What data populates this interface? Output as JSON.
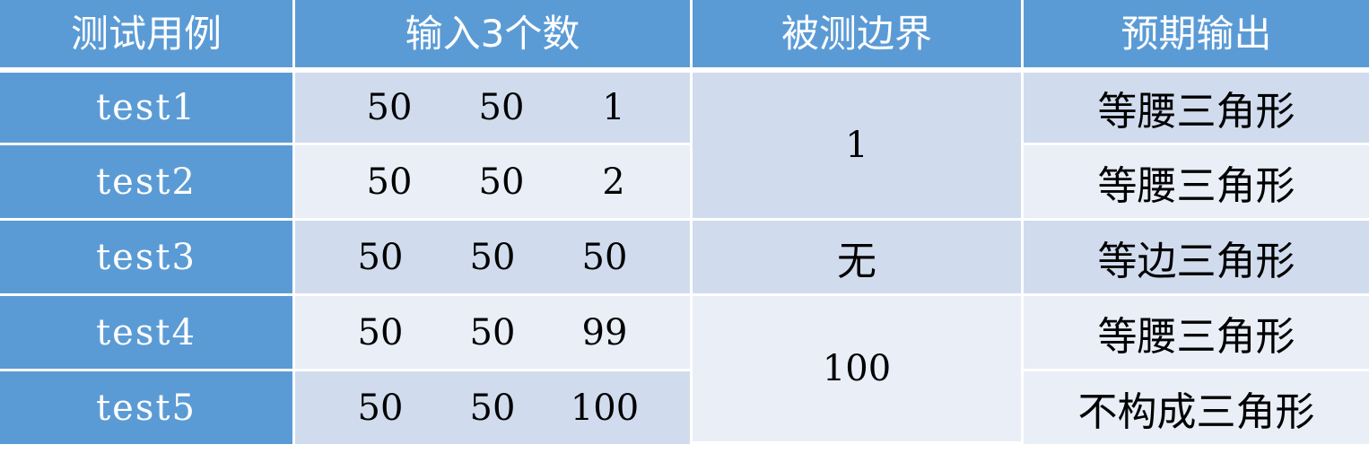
{
  "headers": [
    "测试用例",
    "输入3个数",
    "被测边界",
    "预期输出"
  ],
  "rows": [
    {
      "label": "test1",
      "inputs": [
        "50",
        "50",
        "1"
      ],
      "output": "等腰三角形"
    },
    {
      "label": "test2",
      "inputs": [
        "50",
        "50",
        "2"
      ],
      "output": "等腰三角形"
    },
    {
      "label": "test3",
      "inputs": [
        "50",
        "50",
        "50"
      ],
      "output": "等边三角形"
    },
    {
      "label": "test4",
      "inputs": [
        "50",
        "50",
        "99"
      ],
      "output": "等腰三角形"
    },
    {
      "label": "test5",
      "inputs": [
        "50",
        "50",
        "100"
      ],
      "output": "不构成三角形"
    }
  ],
  "boundaries": [
    "1",
    "无",
    "100"
  ],
  "colors": {
    "header": "#5b9bd5",
    "row_dark": "#d0dcee",
    "row_light": "#e9eef7",
    "header_text": "#ffffff"
  }
}
